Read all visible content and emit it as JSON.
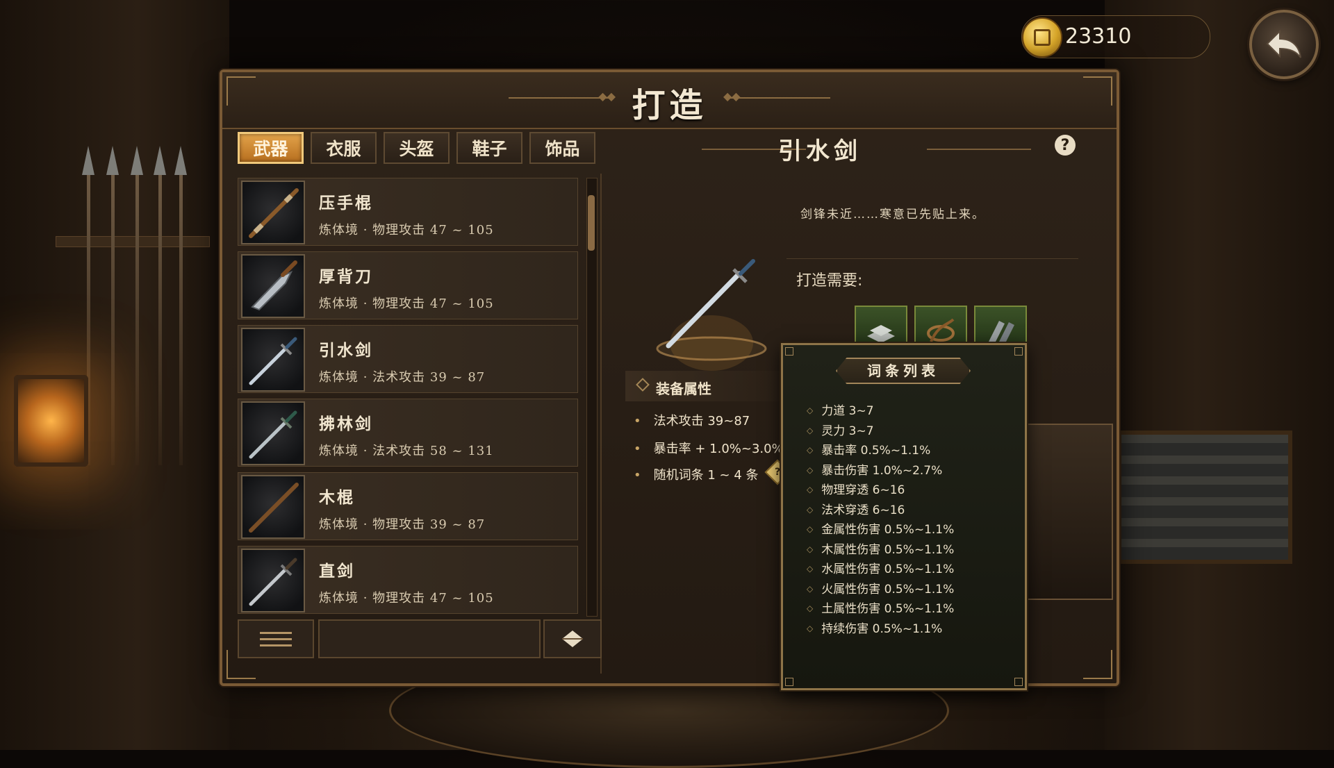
{
  "coins": {
    "value": "23310"
  },
  "panel": {
    "title": "打造"
  },
  "tabs": [
    {
      "label": "武器",
      "active": true
    },
    {
      "label": "衣服",
      "active": false
    },
    {
      "label": "头盔",
      "active": false
    },
    {
      "label": "鞋子",
      "active": false
    },
    {
      "label": "饰品",
      "active": false
    }
  ],
  "weapons": [
    {
      "name": "压手棍",
      "stat": "炼体境 · 物理攻击 47 ~ 105",
      "icon": "staff-icon"
    },
    {
      "name": "厚背刀",
      "stat": "炼体境 · 物理攻击 47 ~ 105",
      "icon": "broadsword-icon"
    },
    {
      "name": "引水剑",
      "stat": "炼体境 · 法术攻击 39 ~ 87",
      "icon": "sword-icon"
    },
    {
      "name": "拂林剑",
      "stat": "炼体境 · 法术攻击 58 ~ 131",
      "icon": "sword-icon"
    },
    {
      "name": "木棍",
      "stat": "炼体境 · 物理攻击 39 ~ 87",
      "icon": "staff-icon"
    },
    {
      "name": "直剑",
      "stat": "炼体境 · 物理攻击 47 ~ 105",
      "icon": "sword-icon"
    }
  ],
  "detail": {
    "name": "引水剑",
    "flavor": "剑锋未近……寒意已先贴上来。",
    "requirement_label": "打造需要:",
    "materials": [
      "iron-ingot-icon",
      "rope-icon",
      "ore-icon"
    ],
    "attr_header": "装备属性",
    "attributes": [
      "法术攻击 39~87",
      "暴击率 + 1.0%~3.0%",
      "随机词条 1 ~ 4 条"
    ]
  },
  "affix": {
    "title": "词条列表",
    "items": [
      "力道 3~7",
      "灵力 3~7",
      "暴击率 0.5%~1.1%",
      "暴击伤害 1.0%~2.7%",
      "物理穿透 6~16",
      "法术穿透 6~16",
      "金属性伤害 0.5%~1.1%",
      "木属性伤害 0.5%~1.1%",
      "水属性伤害 0.5%~1.1%",
      "火属性伤害 0.5%~1.1%",
      "土属性伤害 0.5%~1.1%",
      "持续伤害 0.5%~1.1%"
    ]
  },
  "colors": {
    "accent": "#e3a34a",
    "frame": "#7a5a35",
    "text": "#f1e6cf",
    "material_border": "#7a8a3a"
  }
}
